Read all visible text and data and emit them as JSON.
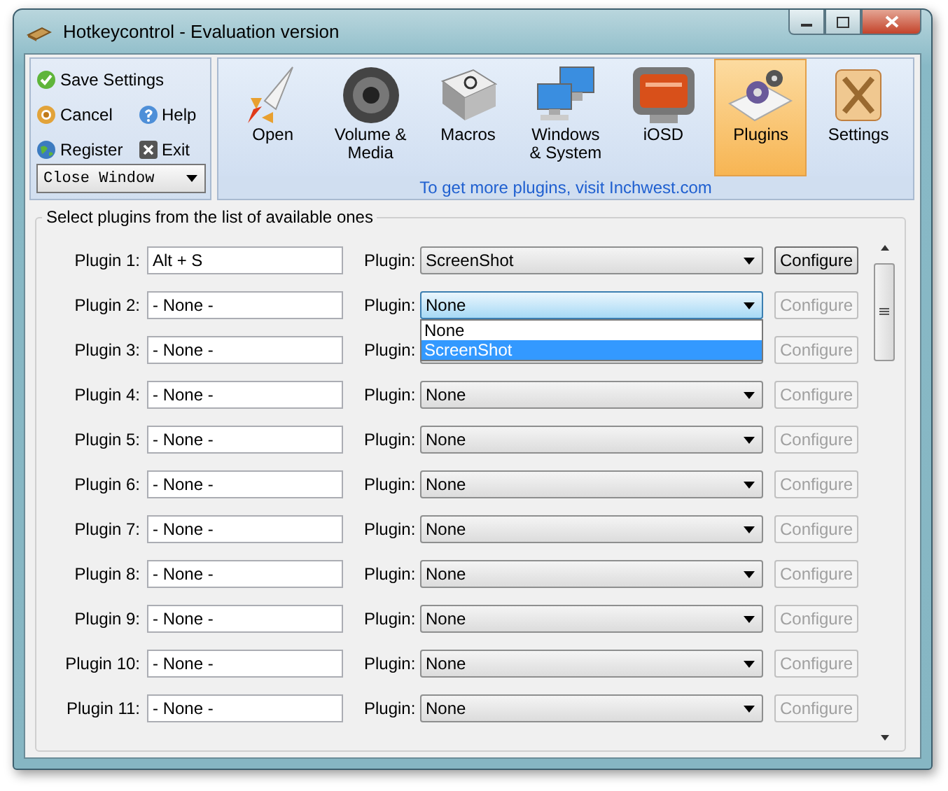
{
  "window": {
    "title": "Hotkeycontrol - Evaluation version"
  },
  "side_actions": [
    {
      "label": "Save Settings",
      "kind": "save"
    },
    {
      "label": "Cancel",
      "kind": "cancel"
    },
    {
      "label": "Help",
      "kind": "help"
    },
    {
      "label": "Register",
      "kind": "register"
    },
    {
      "label": "Exit",
      "kind": "exit"
    }
  ],
  "close_action": {
    "value": "Close Window"
  },
  "tabs": [
    {
      "label": "Open",
      "selected": false
    },
    {
      "label": "Volume &\nMedia",
      "selected": false
    },
    {
      "label": "Macros",
      "selected": false
    },
    {
      "label": "Windows\n& System",
      "selected": false
    },
    {
      "label": "iOSD",
      "selected": false
    },
    {
      "label": "Plugins",
      "selected": true
    },
    {
      "label": "Settings",
      "selected": false
    }
  ],
  "info_link": "To get more plugins, visit Inchwest.com",
  "group": {
    "title": "Select plugins from the list of available ones"
  },
  "rows": [
    {
      "label": "Plugin 1:",
      "hotkey": "Alt + S",
      "plugin_label": "Plugin:",
      "plugin": "ScreenShot",
      "focused": false,
      "configure": "Configure",
      "configure_enabled": true
    },
    {
      "label": "Plugin 2:",
      "hotkey": "- None -",
      "plugin_label": "Plugin:",
      "plugin": "None",
      "focused": true,
      "configure": "Configure",
      "configure_enabled": false,
      "options": [
        {
          "label": "None",
          "selected": false
        },
        {
          "label": "ScreenShot",
          "selected": true
        }
      ]
    },
    {
      "label": "Plugin 3:",
      "hotkey": "- None -",
      "plugin_label": "Plugin:",
      "focused": false,
      "configure": "Configure",
      "configure_enabled": false
    },
    {
      "label": "Plugin 4:",
      "hotkey": "- None -",
      "plugin_label": "Plugin:",
      "plugin": "None",
      "focused": false,
      "configure": "Configure",
      "configure_enabled": false
    },
    {
      "label": "Plugin 5:",
      "hotkey": "- None -",
      "plugin_label": "Plugin:",
      "plugin": "None",
      "focused": false,
      "configure": "Configure",
      "configure_enabled": false
    },
    {
      "label": "Plugin 6:",
      "hotkey": "- None -",
      "plugin_label": "Plugin:",
      "plugin": "None",
      "focused": false,
      "configure": "Configure",
      "configure_enabled": false
    },
    {
      "label": "Plugin 7:",
      "hotkey": "- None -",
      "plugin_label": "Plugin:",
      "plugin": "None",
      "focused": false,
      "configure": "Configure",
      "configure_enabled": false
    },
    {
      "label": "Plugin 8:",
      "hotkey": "- None -",
      "plugin_label": "Plugin:",
      "plugin": "None",
      "focused": false,
      "configure": "Configure",
      "configure_enabled": false
    },
    {
      "label": "Plugin 9:",
      "hotkey": "- None -",
      "plugin_label": "Plugin:",
      "plugin": "None",
      "focused": false,
      "configure": "Configure",
      "configure_enabled": false
    },
    {
      "label": "Plugin 10:",
      "hotkey": "- None -",
      "plugin_label": "Plugin:",
      "plugin": "None",
      "focused": false,
      "configure": "Configure",
      "configure_enabled": false
    },
    {
      "label": "Plugin 11:",
      "hotkey": "- None -",
      "plugin_label": "Plugin:",
      "plugin": "None",
      "focused": false,
      "configure": "Configure",
      "configure_enabled": false
    }
  ]
}
